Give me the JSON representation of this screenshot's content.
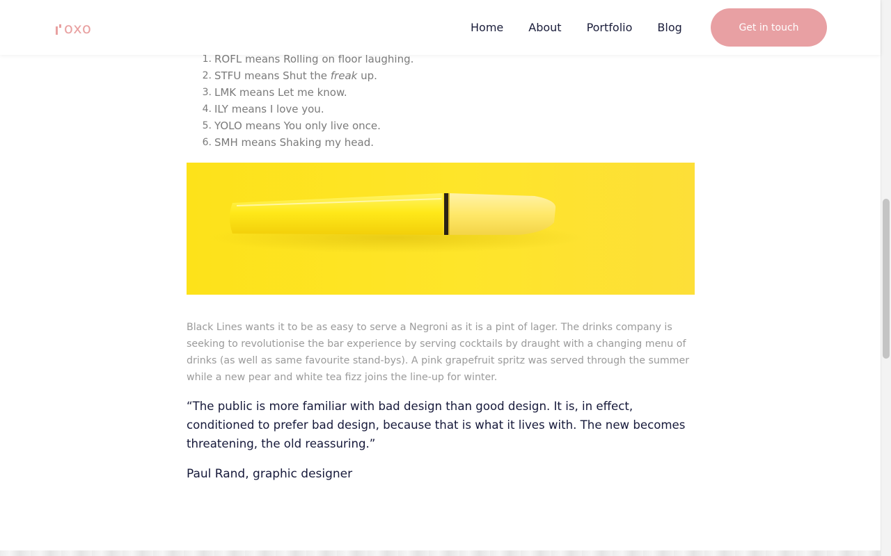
{
  "header": {
    "logo_text": "oxo",
    "nav": [
      {
        "label": "Home"
      },
      {
        "label": "About"
      },
      {
        "label": "Portfolio"
      },
      {
        "label": "Blog"
      }
    ],
    "cta_label": "Get in touch"
  },
  "article": {
    "list": [
      {
        "number": "1.",
        "text": "ROFL means Rolling on floor laughing."
      },
      {
        "number": "2.",
        "prefix": "STFU means Shut the ",
        "emphasis": "freak",
        "suffix": " up."
      },
      {
        "number": "3.",
        "text": "LMK means Let me know."
      },
      {
        "number": "4.",
        "text": "ILY means I love you."
      },
      {
        "number": "5.",
        "text": "YOLO means You only live once."
      },
      {
        "number": "6.",
        "text": "SMH means Shaking my head."
      }
    ],
    "paragraph": "Black Lines wants it to be as easy to serve a Negroni as it is a pint of lager. The drinks company is seeking to revolutionise the bar experience by serving cocktails by draught with a changing menu of drinks (as well as same favourite stand-bys). A pink grapefruit spritz was served through the summer while a new pear and white tea fizz joins the line-up for winter.",
    "quote": "“The public is more familiar with bad design than good design. It is, in effect, conditioned to prefer bad design, because that is what it lives with. The new becomes threatening, the old reassuring.”",
    "quote_author": "Paul Rand, graphic designer"
  },
  "colors": {
    "brand_pink": "#e8a0a3",
    "heading_navy": "#16193a",
    "body_gray": "#9a9a9a",
    "image_yellow": "#fee52a"
  },
  "icons": [
    "logo-mark-icon",
    "yellow-pen-image"
  ]
}
